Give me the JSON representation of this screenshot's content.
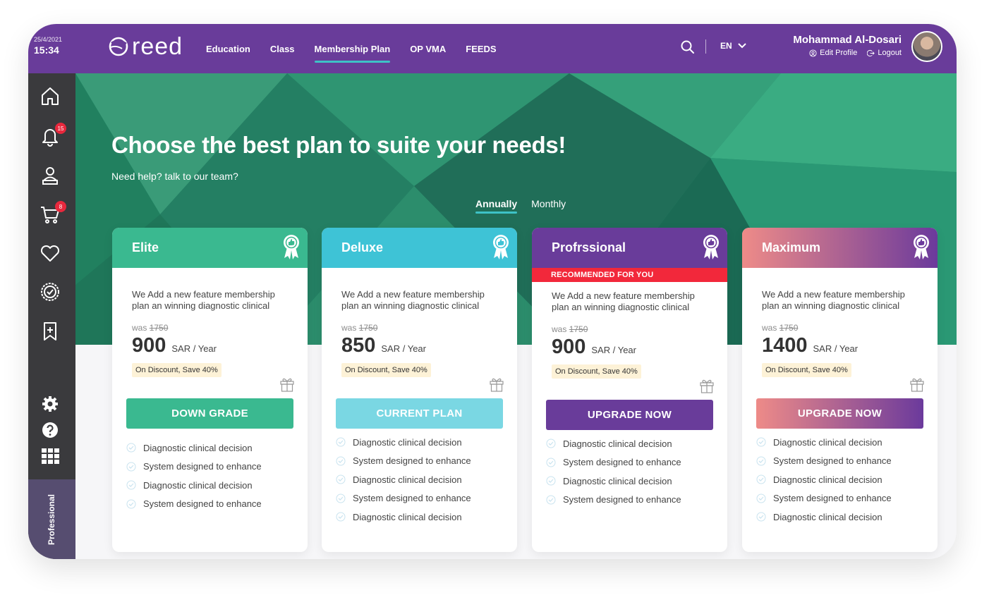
{
  "status": {
    "date": "25/4/2021",
    "time": "15:34"
  },
  "brand": {
    "name": "reed"
  },
  "nav": {
    "items": [
      {
        "label": "Education",
        "active": false
      },
      {
        "label": "Class",
        "active": false
      },
      {
        "label": "Membership Plan",
        "active": true
      },
      {
        "label": "OP VMA",
        "active": false
      },
      {
        "label": "FEEDS",
        "active": false
      }
    ]
  },
  "language": {
    "current": "EN"
  },
  "user": {
    "name": "Mohammad Al-Dosari",
    "edit_profile": "Edit Profile",
    "logout": "Logout"
  },
  "sidebar": {
    "notifications_count": "15",
    "cart_count": "8",
    "plan_label": "Professional"
  },
  "hero": {
    "title": "Choose the best plan to suite your needs!",
    "subtitle": "Need help? talk to our team?",
    "billing_options": [
      "Annually",
      "Monthly"
    ],
    "billing_selected": "Annually"
  },
  "plans": [
    {
      "name": "Elite",
      "description": "We Add a new feature membership plan an winning diagnostic clinical",
      "was_label": "was",
      "old_price": "1750",
      "price": "900",
      "unit": "SAR / Year",
      "discount": "On Discount, Save 40%",
      "button": "DOWN GRADE",
      "features": [
        "Diagnostic clinical decision",
        "System designed to enhance",
        "Diagnostic clinical decision",
        "System designed to enhance"
      ]
    },
    {
      "name": "Deluxe",
      "description": "We Add a new feature membership plan an winning diagnostic clinical",
      "was_label": "was",
      "old_price": "1750",
      "price": "850",
      "unit": "SAR / Year",
      "discount": "On Discount, Save 40%",
      "button": "CURRENT PLAN",
      "features": [
        "Diagnostic clinical decision",
        "System designed to enhance",
        "Diagnostic clinical decision",
        "System designed to enhance",
        "Diagnostic clinical decision"
      ]
    },
    {
      "name": "Profrssional",
      "recommended": "RECOMMENDED FOR YOU",
      "description": "We Add a new feature membership plan an winning diagnostic clinical",
      "was_label": "was",
      "old_price": "1750",
      "price": "900",
      "unit": "SAR / Year",
      "discount": "On Discount, Save 40%",
      "button": "UPGRADE NOW",
      "features": [
        "Diagnostic clinical decision",
        "System designed to enhance",
        "Diagnostic clinical decision",
        "System designed to enhance"
      ]
    },
    {
      "name": "Maximum",
      "description": "We Add a new feature membership plan an winning diagnostic clinical",
      "was_label": "was",
      "old_price": "1750",
      "price": "1400",
      "unit": "SAR / Year",
      "discount": "On Discount, Save 40%",
      "button": "UPGRADE NOW",
      "features": [
        "Diagnostic clinical decision",
        "System designed to enhance",
        "Diagnostic clinical decision",
        "System designed to enhance",
        "Diagnostic clinical decision"
      ]
    }
  ],
  "colors": {
    "topbar": "#693c9a",
    "sidebar": "#3a3a3d",
    "hero_green": "#2a8f6f",
    "elite": "#3ab990",
    "deluxe": "#3ec3d6",
    "professional": "#693c9a",
    "maximum_start": "#ee8b88",
    "maximum_end": "#6b3a9c",
    "recommended": "#f2283b"
  }
}
